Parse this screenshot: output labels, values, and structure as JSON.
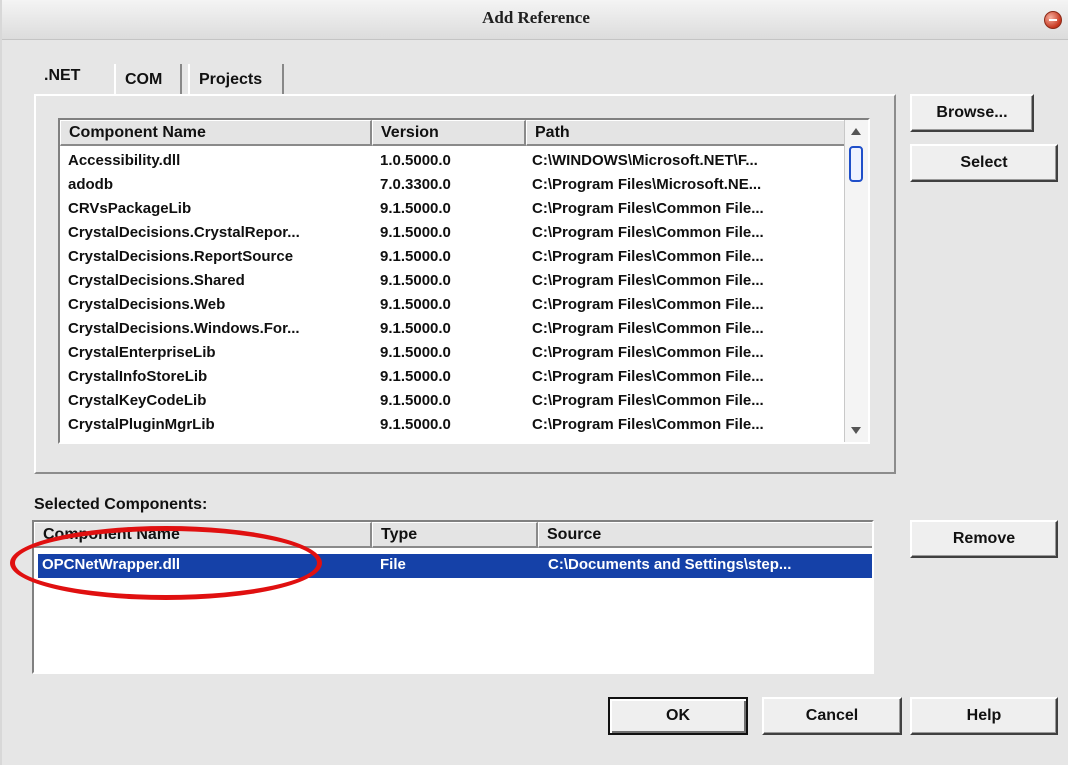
{
  "window": {
    "title": "Add Reference"
  },
  "tabs": [
    {
      "label": ".NET",
      "active": true
    },
    {
      "label": "COM",
      "active": false
    },
    {
      "label": "Projects",
      "active": false
    }
  ],
  "components_list": {
    "columns": [
      "Component Name",
      "Version",
      "Path"
    ],
    "rows": [
      {
        "name": "Accessibility.dll",
        "version": "1.0.5000.0",
        "path": "C:\\WINDOWS\\Microsoft.NET\\F..."
      },
      {
        "name": "adodb",
        "version": "7.0.3300.0",
        "path": "C:\\Program Files\\Microsoft.NE..."
      },
      {
        "name": "CRVsPackageLib",
        "version": "9.1.5000.0",
        "path": "C:\\Program Files\\Common File..."
      },
      {
        "name": "CrystalDecisions.CrystalRepor...",
        "version": "9.1.5000.0",
        "path": "C:\\Program Files\\Common File..."
      },
      {
        "name": "CrystalDecisions.ReportSource",
        "version": "9.1.5000.0",
        "path": "C:\\Program Files\\Common File..."
      },
      {
        "name": "CrystalDecisions.Shared",
        "version": "9.1.5000.0",
        "path": "C:\\Program Files\\Common File..."
      },
      {
        "name": "CrystalDecisions.Web",
        "version": "9.1.5000.0",
        "path": "C:\\Program Files\\Common File..."
      },
      {
        "name": "CrystalDecisions.Windows.For...",
        "version": "9.1.5000.0",
        "path": "C:\\Program Files\\Common File..."
      },
      {
        "name": "CrystalEnterpriseLib",
        "version": "9.1.5000.0",
        "path": "C:\\Program Files\\Common File..."
      },
      {
        "name": "CrystalInfoStoreLib",
        "version": "9.1.5000.0",
        "path": "C:\\Program Files\\Common File..."
      },
      {
        "name": "CrystalKeyCodeLib",
        "version": "9.1.5000.0",
        "path": "C:\\Program Files\\Common File..."
      },
      {
        "name": "CrystalPluginMgrLib",
        "version": "9.1.5000.0",
        "path": "C:\\Program Files\\Common File..."
      }
    ]
  },
  "selected_section": {
    "label": "Selected Components:",
    "columns": [
      "Component Name",
      "Type",
      "Source"
    ],
    "rows": [
      {
        "name": "OPCNetWrapper.dll",
        "type": "File",
        "source": "C:\\Documents and Settings\\step...",
        "selected": true
      }
    ]
  },
  "buttons": {
    "browse": "Browse...",
    "select": "Select",
    "remove": "Remove",
    "ok": "OK",
    "cancel": "Cancel",
    "help": "Help"
  },
  "colors": {
    "selection": "#1541a8",
    "annotation": "#e01010"
  }
}
